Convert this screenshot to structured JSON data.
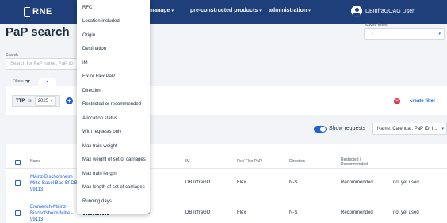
{
  "app": {
    "logo_text": "RNE",
    "nav": [
      {
        "label": "manage"
      },
      {
        "label": "pre-constructed products"
      },
      {
        "label": "administration"
      }
    ],
    "user_name": "DBInfraGOAG User"
  },
  "page": {
    "title": "PaP search",
    "saved_filters": {
      "label": "Saved filters",
      "value": "-"
    },
    "search": {
      "label": "Search",
      "placeholder": "Search for PaP name, PaP ID"
    },
    "filters_label": "Filters"
  },
  "filter_panel": {
    "chip": {
      "key": "TTP",
      "operator": "is",
      "value": "2025"
    },
    "create_filter_label": "create filter"
  },
  "results_bar": {
    "show_requests_label": "Show requests",
    "show_requests_on": true,
    "sort_value": "Name, Calendar, PaP ID, I..."
  },
  "table": {
    "headers": {
      "name": "Name",
      "im": "IM",
      "fix_flex": "Fix / Flex PaP",
      "direction": "Direction",
      "restricted": "Restricted / Recommended"
    },
    "rows": [
      {
        "name": "Mainz-Bischofsheim Mitte-Basel Bad Bf DB - 99113",
        "pap_id": "",
        "days": "",
        "im": "DB InfraGO",
        "fix_flex": "Flex",
        "direction": "N-S",
        "restricted": "Recommended",
        "usage": "not yet used"
      },
      {
        "name": "Emmerich-Mainz-Bischofsheim Mitte - 99113",
        "pap_id": "268315",
        "days": "1-7",
        "im": "DB InfraGO",
        "fix_flex": "Flex",
        "direction": "N-S",
        "restricted": "Recommended",
        "usage": "not yet used"
      }
    ]
  },
  "menu": {
    "items": [
      "RFC",
      "Location included",
      "Origin",
      "Destination",
      "IM",
      "Fix or Flex PaP",
      "Direction",
      "Restricted or recommended",
      "Allocation status",
      "With requests only",
      "Max train weight",
      "Max weight of set of carriages",
      "Max train length",
      "Max length of set of carriages",
      "Running days"
    ]
  },
  "icons": {
    "user": "user-avatar-icon",
    "filter": "funnel-icon",
    "add": "plus-circle-icon",
    "clear": "close-circle-icon",
    "chevron": "chevron-down-icon"
  },
  "colors": {
    "header": "#1f3f7a",
    "accent": "#1f5fd6",
    "danger": "#e0364a"
  }
}
